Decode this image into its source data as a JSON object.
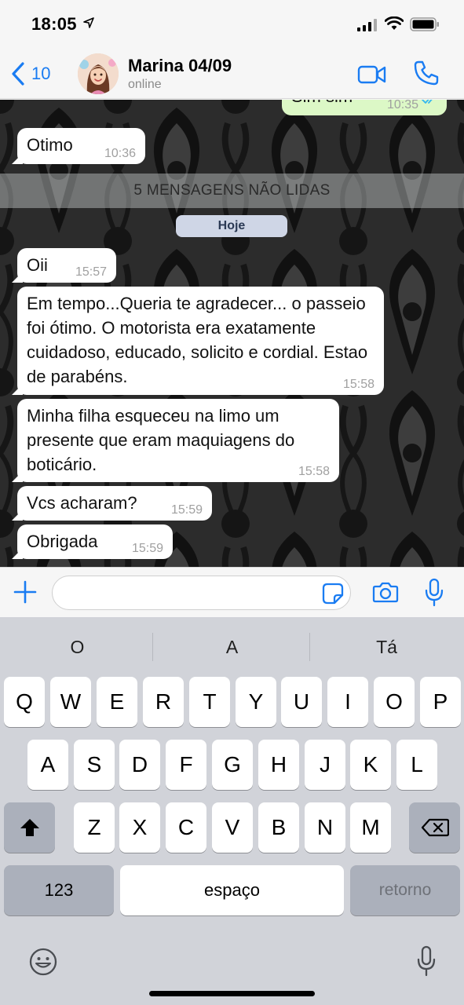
{
  "status_bar": {
    "time": "18:05"
  },
  "header": {
    "back_count": "10",
    "contact_name": "Marina 04/09",
    "contact_status": "online"
  },
  "chat": {
    "partial_outgoing": {
      "text": "Sim sim",
      "time": "10:35"
    },
    "messages_before": [
      {
        "text": "Otimo",
        "time": "10:36"
      }
    ],
    "unread_banner": "5 MENSAGENS NÃO LIDAS",
    "date_separator": "Hoje",
    "messages_after": [
      {
        "text": "Oii",
        "time": "15:57"
      },
      {
        "text": "Em tempo...Queria te agradecer... o passeio foi ótimo. O motorista era exatamente cuidadoso, educado, solicito e cordial. Estao de parabéns.",
        "time": "15:58"
      },
      {
        "text": "Minha filha esqueceu na limo um presente que eram maquiagens do boticário.",
        "time": "15:58"
      },
      {
        "text": "Vcs acharam?",
        "time": "15:59"
      },
      {
        "text": "Obrigada",
        "time": "15:59"
      }
    ]
  },
  "input": {
    "value": "",
    "placeholder": ""
  },
  "keyboard": {
    "suggestions": [
      "O",
      "A",
      "Tá"
    ],
    "row1": [
      "Q",
      "W",
      "E",
      "R",
      "T",
      "Y",
      "U",
      "I",
      "O",
      "P"
    ],
    "row2": [
      "A",
      "S",
      "D",
      "F",
      "G",
      "H",
      "J",
      "K",
      "L"
    ],
    "row3": [
      "Z",
      "X",
      "C",
      "V",
      "B",
      "N",
      "M"
    ],
    "numbers_key": "123",
    "space_key": "espaço",
    "return_key": "retorno"
  },
  "colors": {
    "accent": "#1a7cf2",
    "incoming_bubble": "#ffffff",
    "outgoing_bubble": "#dcf8c6",
    "read_ticks": "#34b7f1"
  },
  "icons": [
    "location-arrow-icon",
    "signal-icon",
    "wifi-icon",
    "battery-icon",
    "chevron-left-icon",
    "video-camera-icon",
    "phone-icon",
    "plus-icon",
    "sticker-icon",
    "camera-icon",
    "microphone-icon",
    "shift-icon",
    "backspace-icon",
    "emoji-icon",
    "double-check-icon"
  ]
}
